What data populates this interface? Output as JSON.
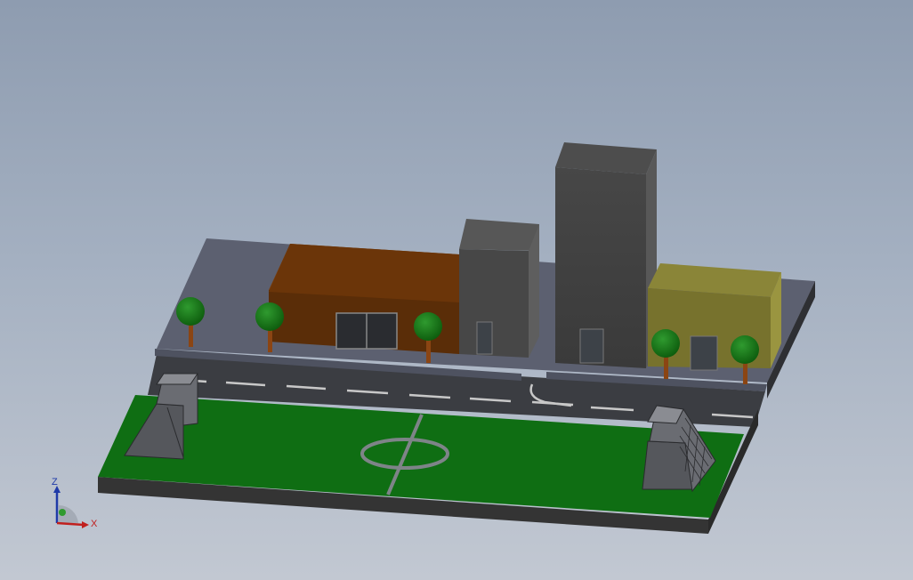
{
  "viewport": {
    "background_top": "#8e9cb0",
    "background_bottom": "#c2c8d2"
  },
  "scene": {
    "colors": {
      "base_side": "#3a3a3a",
      "field_grass": "#0f6e13",
      "field_lines": "#7e8488",
      "road": "#3c3e42",
      "road_dash": "#c8c8c8",
      "sidewalk_top": "#5a5e6c",
      "brown_building": "#5a2d08",
      "gray_building": "#474747",
      "tower": "#404040",
      "olive_building": "#77722d",
      "tree_crown": "#1a7a1a",
      "tree_trunk": "#8b4513",
      "door": "#3d4248"
    }
  },
  "triad": {
    "z_label": "Z",
    "x_label": "X",
    "z_color": "#1f3aa8",
    "x_color": "#c0201e",
    "y_color": "#2f9a2f"
  }
}
